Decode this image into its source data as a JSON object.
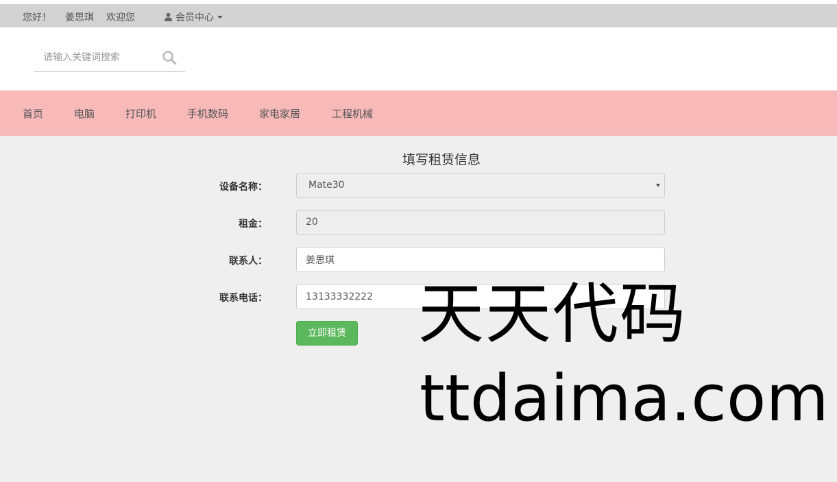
{
  "topbar": {
    "greeting": "您好！",
    "username": "姜思琪",
    "welcome": "欢迎您",
    "member_center": "会员中心"
  },
  "search": {
    "placeholder": "请输入关键词搜索",
    "value": ""
  },
  "nav": {
    "items": [
      "首页",
      "电脑",
      "打印机",
      "手机数码",
      "家电家居",
      "工程机械"
    ]
  },
  "form": {
    "title": "填写租赁信息",
    "device_label": "设备名称：",
    "device_value": "Mate30",
    "rent_label": "租金：",
    "rent_value": "20",
    "contact_label": "联系人：",
    "contact_value": "姜思琪",
    "phone_label": "联系电话：",
    "phone_value": "13133332222",
    "submit_label": "立即租赁"
  },
  "watermark": {
    "cn": "天天代码",
    "en": "ttdaima.com"
  },
  "colors": {
    "topbar_bg": "#d3d3d3",
    "nav_bg": "#f8b9b9",
    "page_bg": "#efefef",
    "submit_bg": "#5cb85c"
  }
}
